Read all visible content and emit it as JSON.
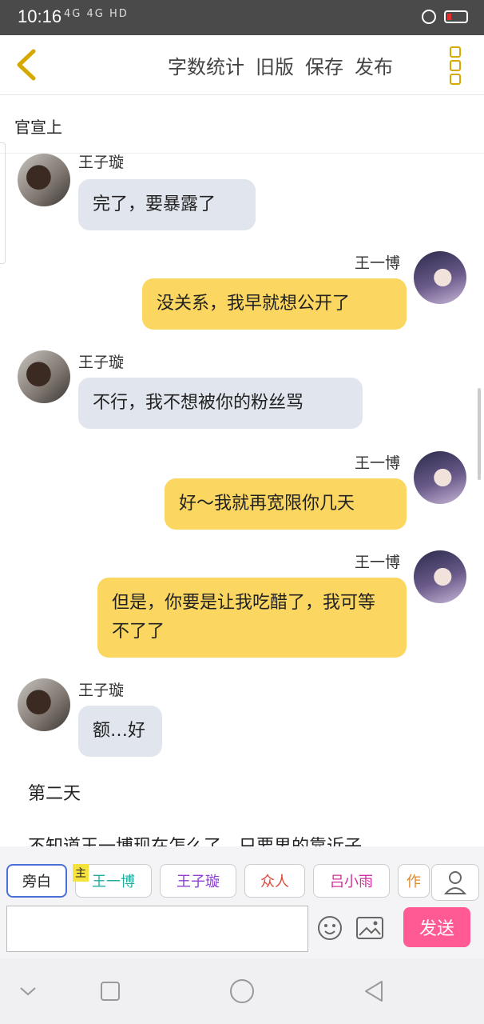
{
  "status": {
    "time": "10:16",
    "signals": "4G 4G HD"
  },
  "toolbar": {
    "buttons": [
      "字数统计",
      "旧版",
      "保存",
      "发布"
    ]
  },
  "chapter": {
    "title": "官宣上"
  },
  "messages": [
    {
      "side": "left",
      "name": "王子璇",
      "text": "完了，要暴露了"
    },
    {
      "side": "right",
      "name": "王一博",
      "text": "没关系，我早就想公开了"
    },
    {
      "side": "left",
      "name": "王子璇",
      "text": "不行，我不想被你的粉丝骂"
    },
    {
      "side": "right",
      "name": "王一博",
      "text": "好～我就再宽限你几天"
    },
    {
      "side": "right",
      "name": "王一博",
      "text": "但是，你要是让我吃醋了，我可等不了了"
    },
    {
      "side": "left",
      "name": "王子璇",
      "text": "额…好"
    }
  ],
  "narration": [
    "第二天",
    "不知道王一博现在怎么了，只要男的靠近子"
  ],
  "roles": {
    "main_tag": "主",
    "items": [
      {
        "label": "旁白",
        "color": "#333333"
      },
      {
        "label": "王一博",
        "color": "#1fae9e"
      },
      {
        "label": "王子璇",
        "color": "#8b3fd0"
      },
      {
        "label": "众人",
        "color": "#e0453a"
      },
      {
        "label": "吕小雨",
        "color": "#d0309a"
      },
      {
        "label": "作",
        "color": "#e08a30"
      }
    ]
  },
  "input": {
    "placeholder": ""
  },
  "send": {
    "label": "发送"
  }
}
